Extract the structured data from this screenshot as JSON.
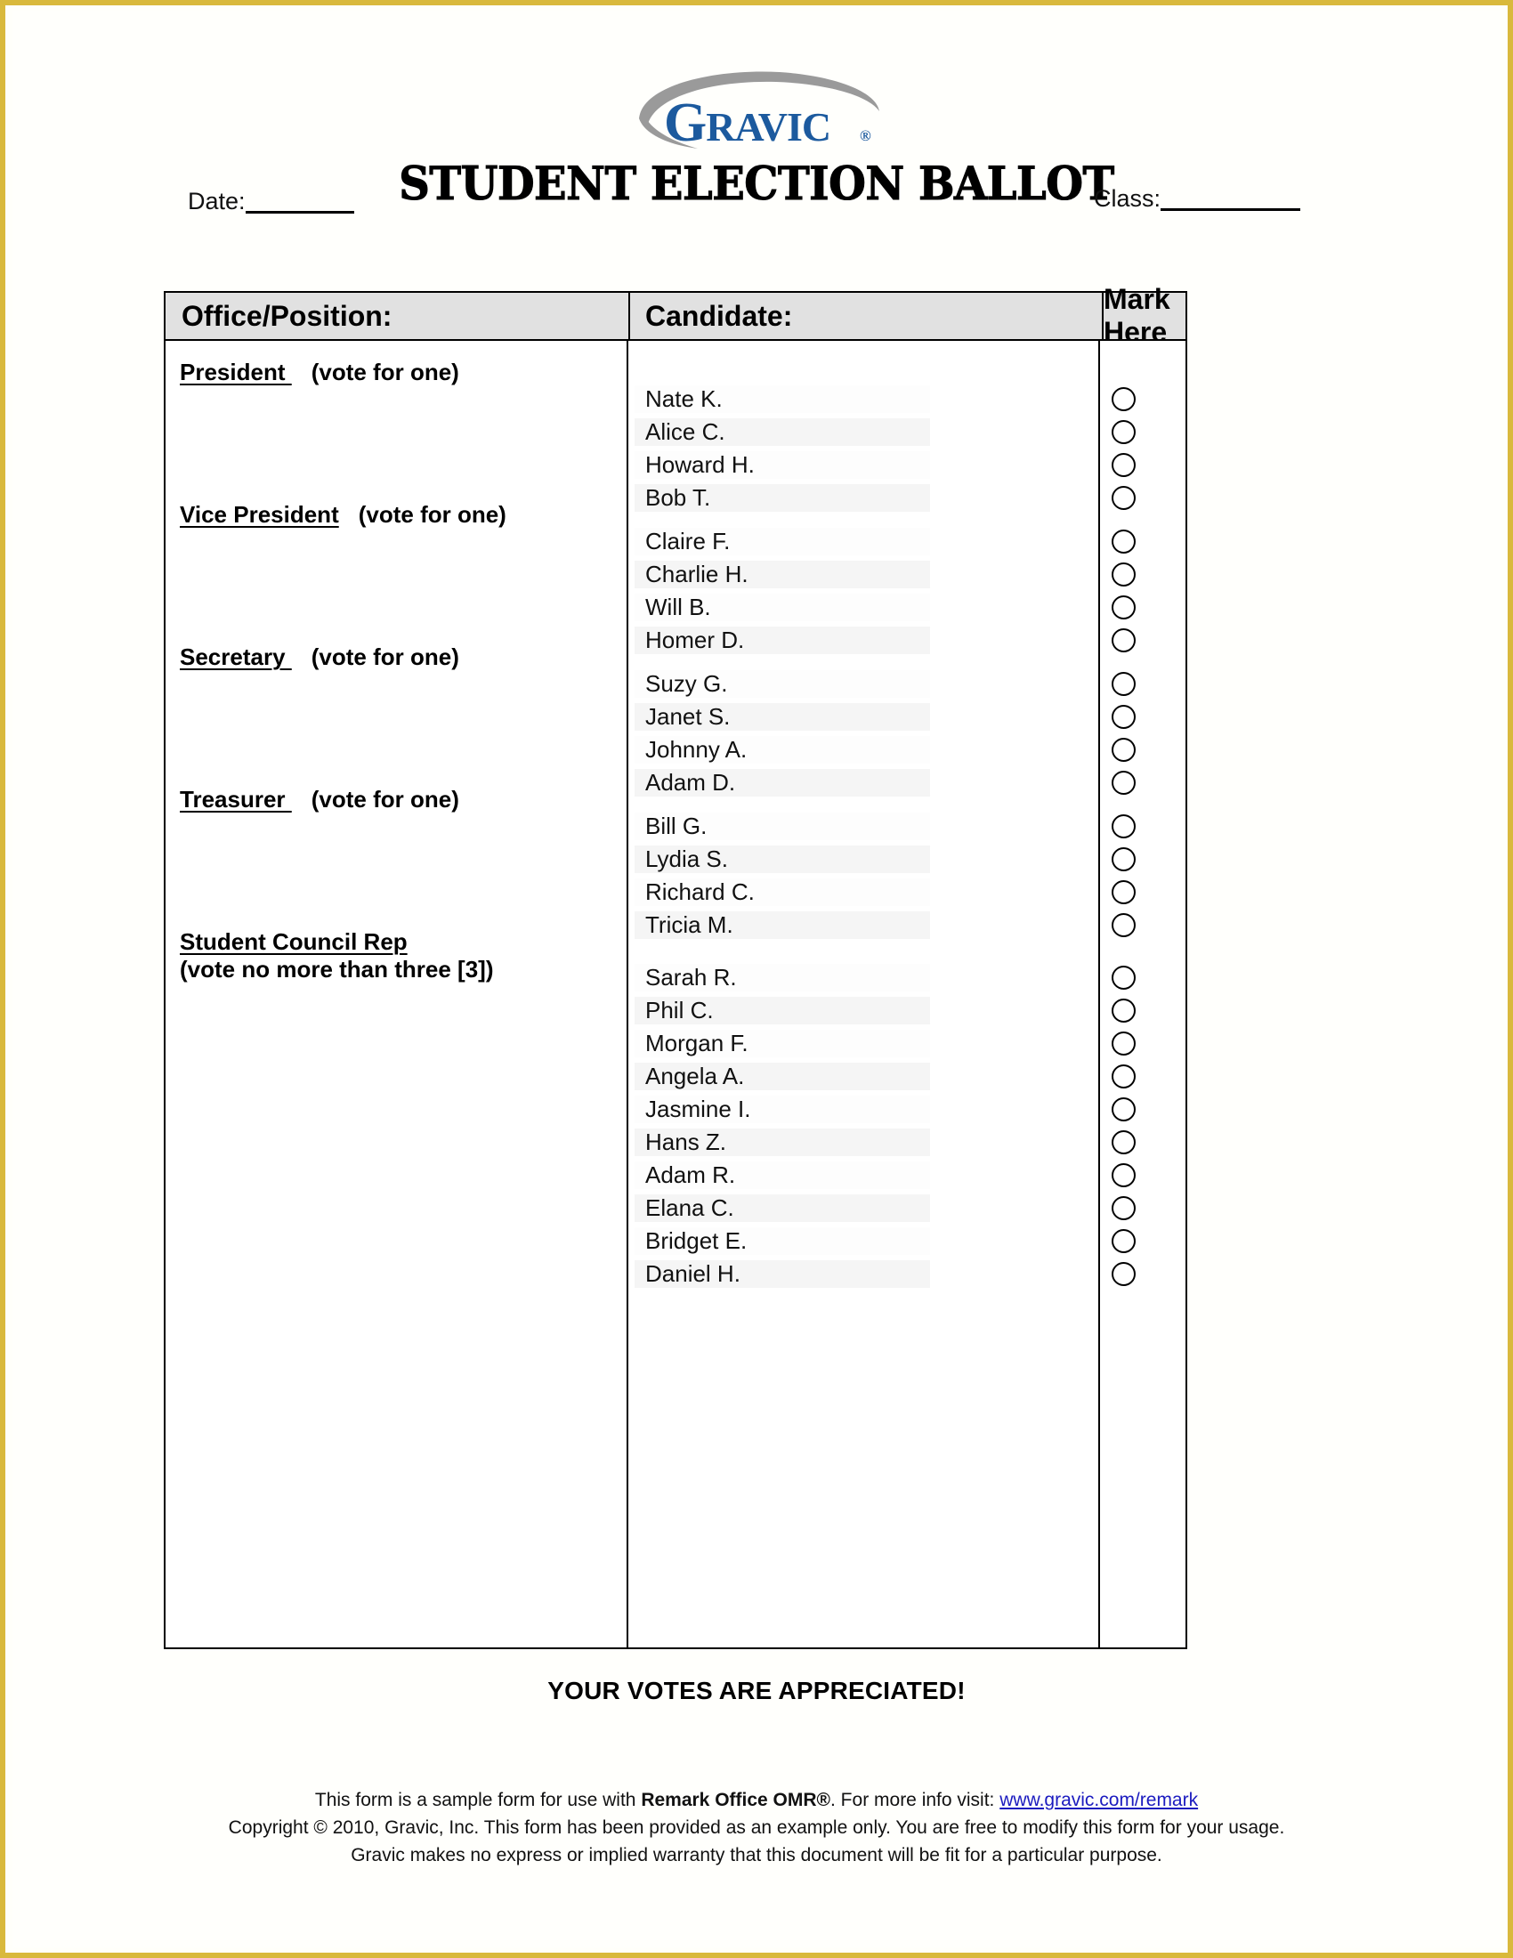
{
  "brand": {
    "logo_text_main": "G",
    "logo_text_rest": "RAVIC",
    "logo_registered": "®",
    "logo_name": "GRAVIC",
    "logo_blue": "#1c5a9e",
    "logo_swoosh_gray": "#9a9a9a"
  },
  "header": {
    "title": "STUDENT ELECTION BALLOT",
    "date_label": "Date:",
    "date_value": "",
    "class_label": "Class:",
    "class_value": ""
  },
  "table": {
    "columns": [
      "Office/Position:",
      "Candidate:",
      "Mark Here"
    ],
    "sections": [
      {
        "office": "President ",
        "instruction": "(vote for one)",
        "instruction_inline": true,
        "candidates": [
          "Nate K.",
          "Alice C.",
          "Howard H.",
          "Bob T."
        ]
      },
      {
        "office": "Vice President",
        "instruction": "(vote for one)",
        "instruction_inline": true,
        "candidates": [
          "Claire F.",
          "Charlie H.",
          "Will B.",
          "Homer D."
        ]
      },
      {
        "office": "Secretary ",
        "instruction": "(vote for one)",
        "instruction_inline": true,
        "candidates": [
          "Suzy G.",
          "Janet S.",
          "Johnny A.",
          "Adam D."
        ]
      },
      {
        "office": "Treasurer ",
        "instruction": "(vote for one)",
        "instruction_inline": true,
        "candidates": [
          "Bill G.",
          "Lydia S.",
          "Richard C.",
          "Tricia M."
        ]
      },
      {
        "office": "Student Council Rep",
        "instruction": "(vote no more than three [3])",
        "instruction_inline": false,
        "candidates": [
          "Sarah R.",
          "Phil C.",
          "Morgan F.",
          "Angela A.",
          "Jasmine I.",
          "Hans Z.",
          "Adam R.",
          "Elana C.",
          "Bridget E.",
          "Daniel H."
        ]
      }
    ]
  },
  "footer": {
    "thanks": "YOUR VOTES ARE APPRECIATED!",
    "line1_pre": "This form is a sample form for use with ",
    "line1_product": "Remark Office OMR®",
    "line1_mid": ". For more info visit: ",
    "line1_link": "www.gravic.com/remark",
    "line2": "Copyright © 2010, Gravic, Inc. This form has been provided as an example only. You are free to modify this form for your usage.",
    "line3": "Gravic makes no express or implied warranty that this document will be fit for a particular purpose."
  },
  "style": {
    "page_border_color": "#d9b93c",
    "header_fill": "#e1e1e1",
    "row_band": "#f5f5f5"
  }
}
